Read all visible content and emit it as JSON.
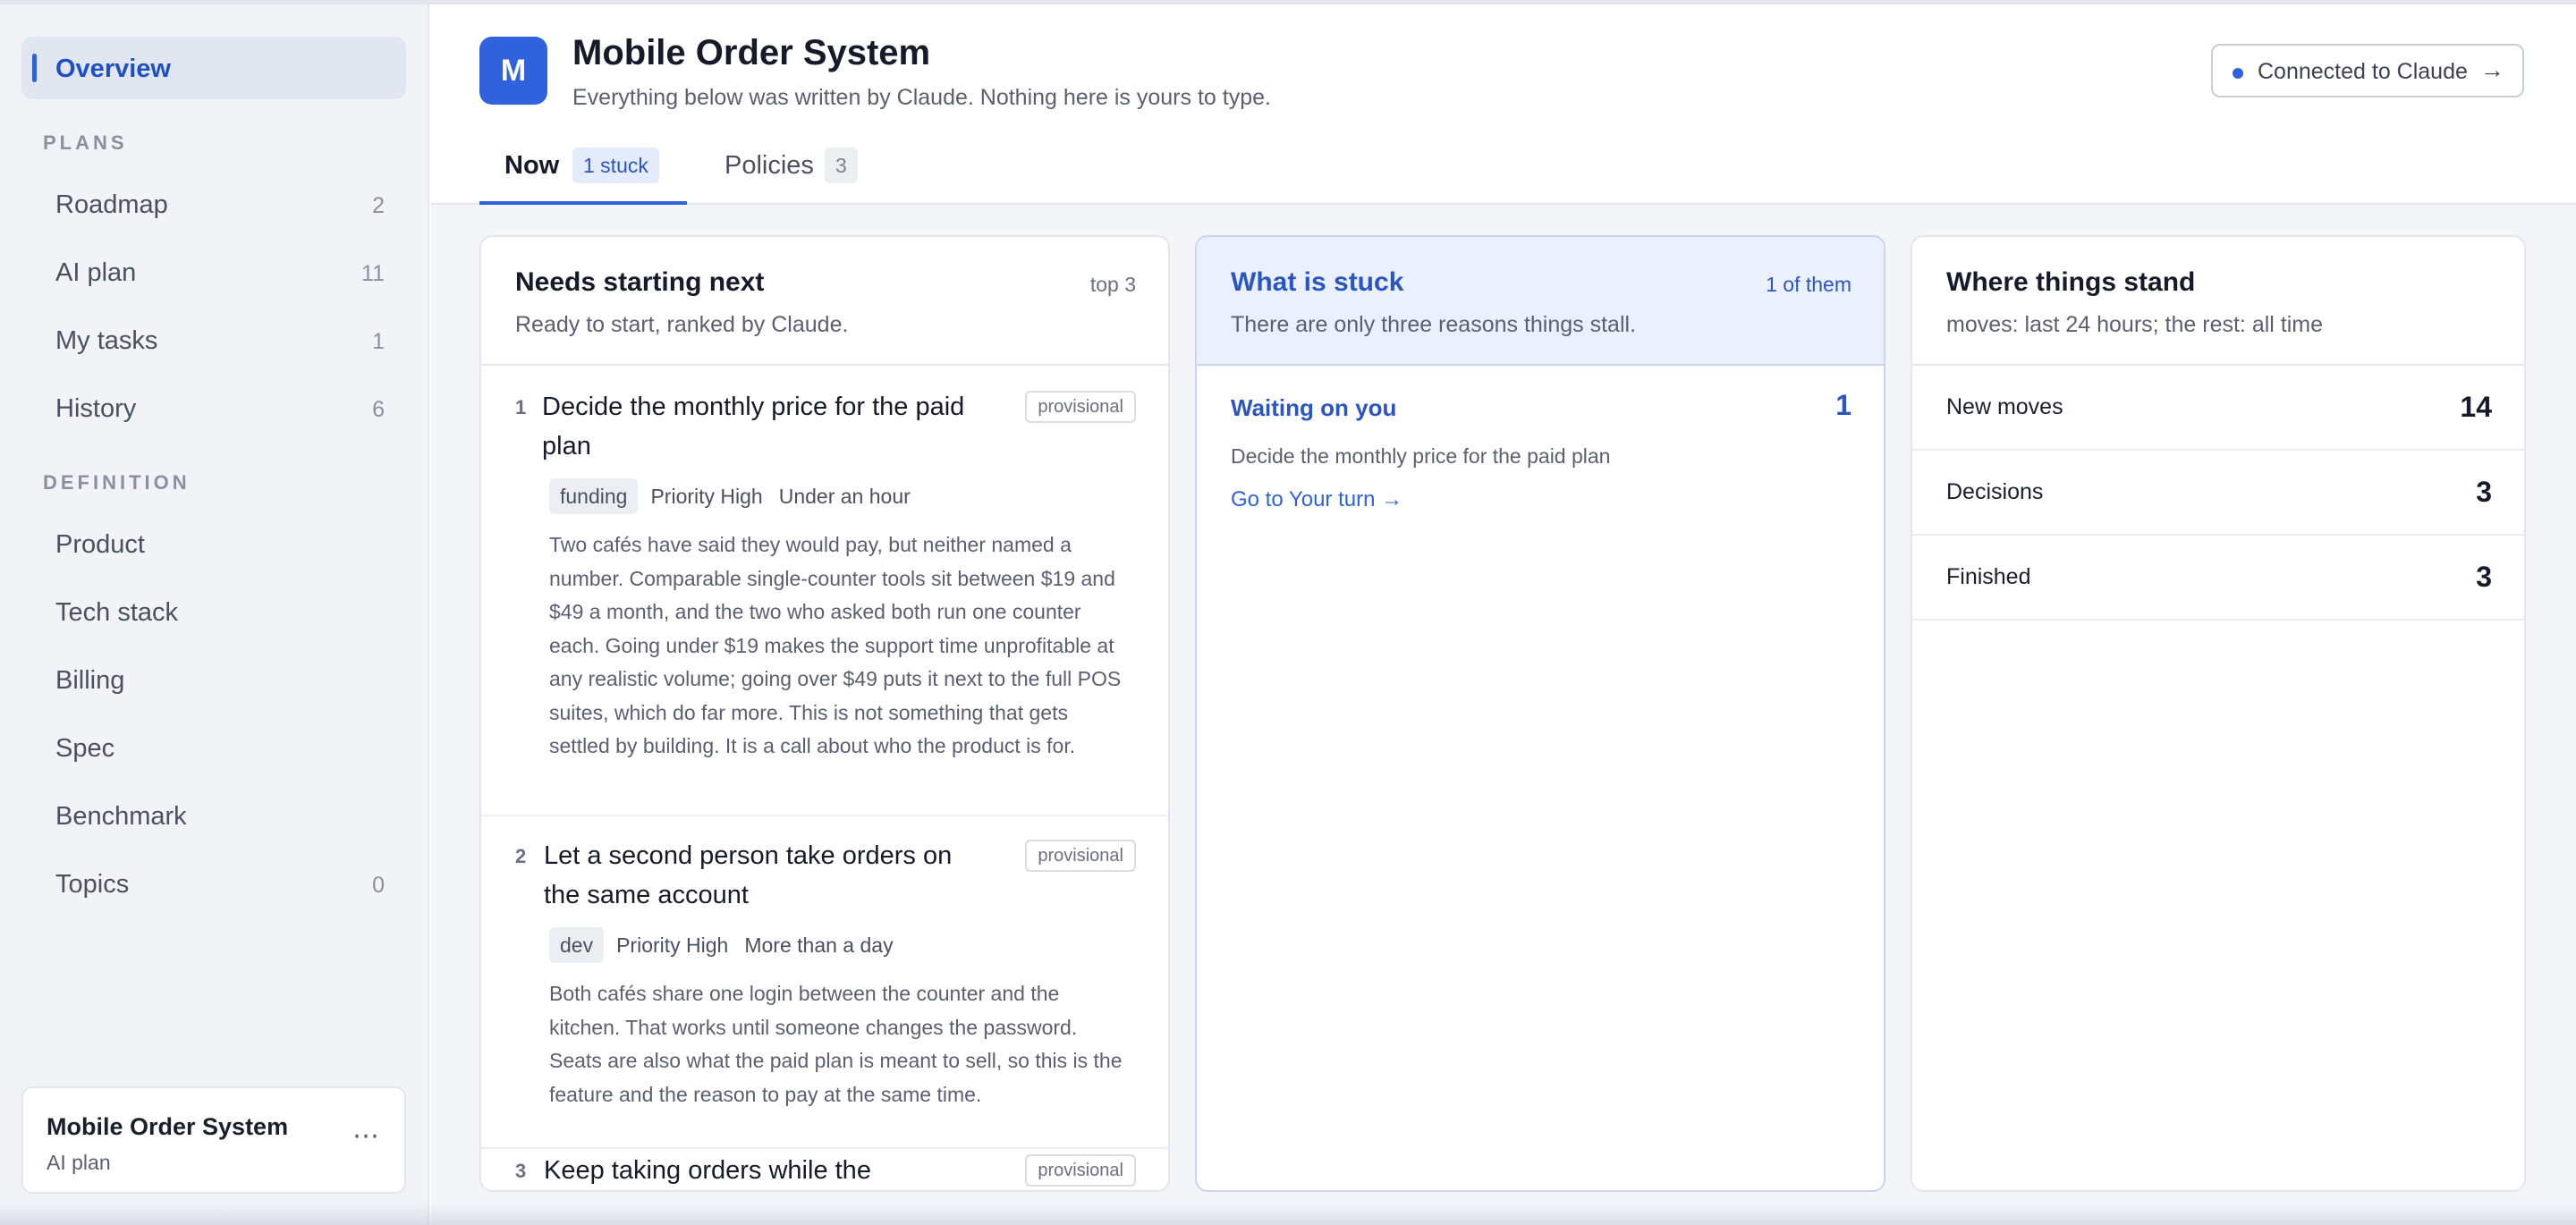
{
  "sidebar": {
    "overview": "Overview",
    "plans_heading": "PLANS",
    "definition_heading": "DEFINITION",
    "plans": [
      {
        "label": "Roadmap",
        "count": "2"
      },
      {
        "label": "AI plan",
        "count": "11"
      },
      {
        "label": "My tasks",
        "count": "1"
      },
      {
        "label": "History",
        "count": "6"
      }
    ],
    "definition": [
      {
        "label": "Product",
        "count": ""
      },
      {
        "label": "Tech stack",
        "count": ""
      },
      {
        "label": "Billing",
        "count": ""
      },
      {
        "label": "Spec",
        "count": ""
      },
      {
        "label": "Benchmark",
        "count": ""
      },
      {
        "label": "Topics",
        "count": "0"
      }
    ],
    "project": {
      "name": "Mobile Order System",
      "sub": "AI plan",
      "menu": "⋯"
    }
  },
  "header": {
    "logo_letter": "M",
    "title": "Mobile Order System",
    "subtitle": "Everything below was written by Claude. Nothing here is yours to type.",
    "connection": {
      "label": "Connected to Claude",
      "arrow": "→"
    },
    "tabs": [
      {
        "label": "Now",
        "badge": "1 stuck"
      },
      {
        "label": "Policies",
        "badge": "3"
      }
    ]
  },
  "colors": {
    "accent": "#2f62dc",
    "stuck_bg": "#eaf1fd"
  },
  "next": {
    "title": "Needs starting next",
    "meta": "top 3",
    "subtitle": "Ready to start, ranked by Claude.",
    "tasks": [
      {
        "num": "1",
        "title": "Decide the monthly price for the paid plan",
        "status": "provisional",
        "tag": "funding",
        "priority": "Priority High",
        "effort": "Under an hour",
        "body": "Two cafés have said they would pay, but neither named a number. Comparable single-counter tools sit between $19 and $49 a month, and the two who asked both run one counter each. Going under $19 makes the support time unprofitable at any realistic volume; going over $49 puts it next to the full POS suites, which do far more. This is not something that gets settled by building. It is a call about who the product is for."
      },
      {
        "num": "2",
        "title": "Let a second person take orders on the same account",
        "status": "provisional",
        "tag": "dev",
        "priority": "Priority High",
        "effort": "More than a day",
        "body": "Both cafés share one login between the counter and the kitchen. That works until someone changes the password. Seats are also what the paid plan is meant to sell, so this is the feature and the reason to pay at the same time."
      },
      {
        "num": "3",
        "title": "Keep taking orders while the",
        "status": "provisional"
      }
    ]
  },
  "stuck": {
    "title": "What is stuck",
    "meta": "1 of them",
    "subtitle": "There are only three reasons things stall.",
    "row": {
      "title": "Waiting on you",
      "count": "1",
      "desc": "Decide the monthly price for the paid plan",
      "link": "Go to Your turn →"
    }
  },
  "standing": {
    "title": "Where things stand",
    "subtitle": "moves: last 24 hours; the rest: all time",
    "stats": [
      {
        "label": "New moves",
        "value": "14"
      },
      {
        "label": "Decisions",
        "value": "3"
      },
      {
        "label": "Finished",
        "value": "3"
      }
    ]
  }
}
